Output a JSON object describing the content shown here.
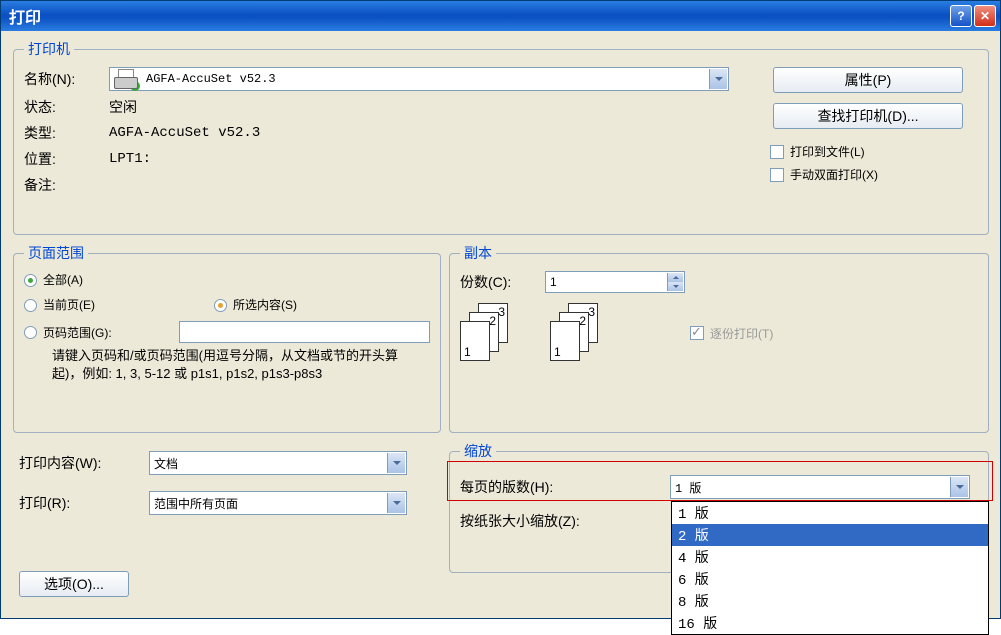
{
  "titlebar": {
    "title": "打印"
  },
  "printer": {
    "legend": "打印机",
    "name_label": "名称(N):",
    "name_value": "AGFA-AccuSet v52.3",
    "status_label": "状态:",
    "status_value": "空闲",
    "type_label": "类型:",
    "type_value": "AGFA-AccuSet v52.3",
    "location_label": "位置:",
    "location_value": "LPT1:",
    "comment_label": "备注:",
    "comment_value": "",
    "properties_btn": "属性(P)",
    "find_btn": "查找打印机(D)...",
    "print_to_file": "打印到文件(L)",
    "manual_duplex": "手动双面打印(X)"
  },
  "page_range": {
    "legend": "页面范围",
    "all": "全部(A)",
    "current": "当前页(E)",
    "selection": "所选内容(S)",
    "pages": "页码范围(G):",
    "hint": "请键入页码和/或页码范围(用逗号分隔，从文档或节的开头算起)，例如: 1, 3, 5-12 或 p1s1, p1s2, p1s3-p8s3"
  },
  "copies": {
    "legend": "副本",
    "count_label": "份数(C):",
    "count_value": "1",
    "collate": "逐份打印(T)"
  },
  "print_what": {
    "label": "打印内容(W):",
    "value": "文档"
  },
  "print_which": {
    "label": "打印(R):",
    "value": "范围中所有页面"
  },
  "zoom": {
    "legend": "缩放",
    "pages_per_sheet_label": "每页的版数(H):",
    "pages_per_sheet_value": "1 版",
    "scale_to_paper_label": "按纸张大小缩放(Z):",
    "options": [
      "1 版",
      "2 版",
      "4 版",
      "6 版",
      "8 版",
      "16 版"
    ],
    "highlighted": "2 版"
  },
  "options_btn": "选项(O)...",
  "collate_nums": {
    "one": "1",
    "two": "2",
    "three": "3"
  }
}
